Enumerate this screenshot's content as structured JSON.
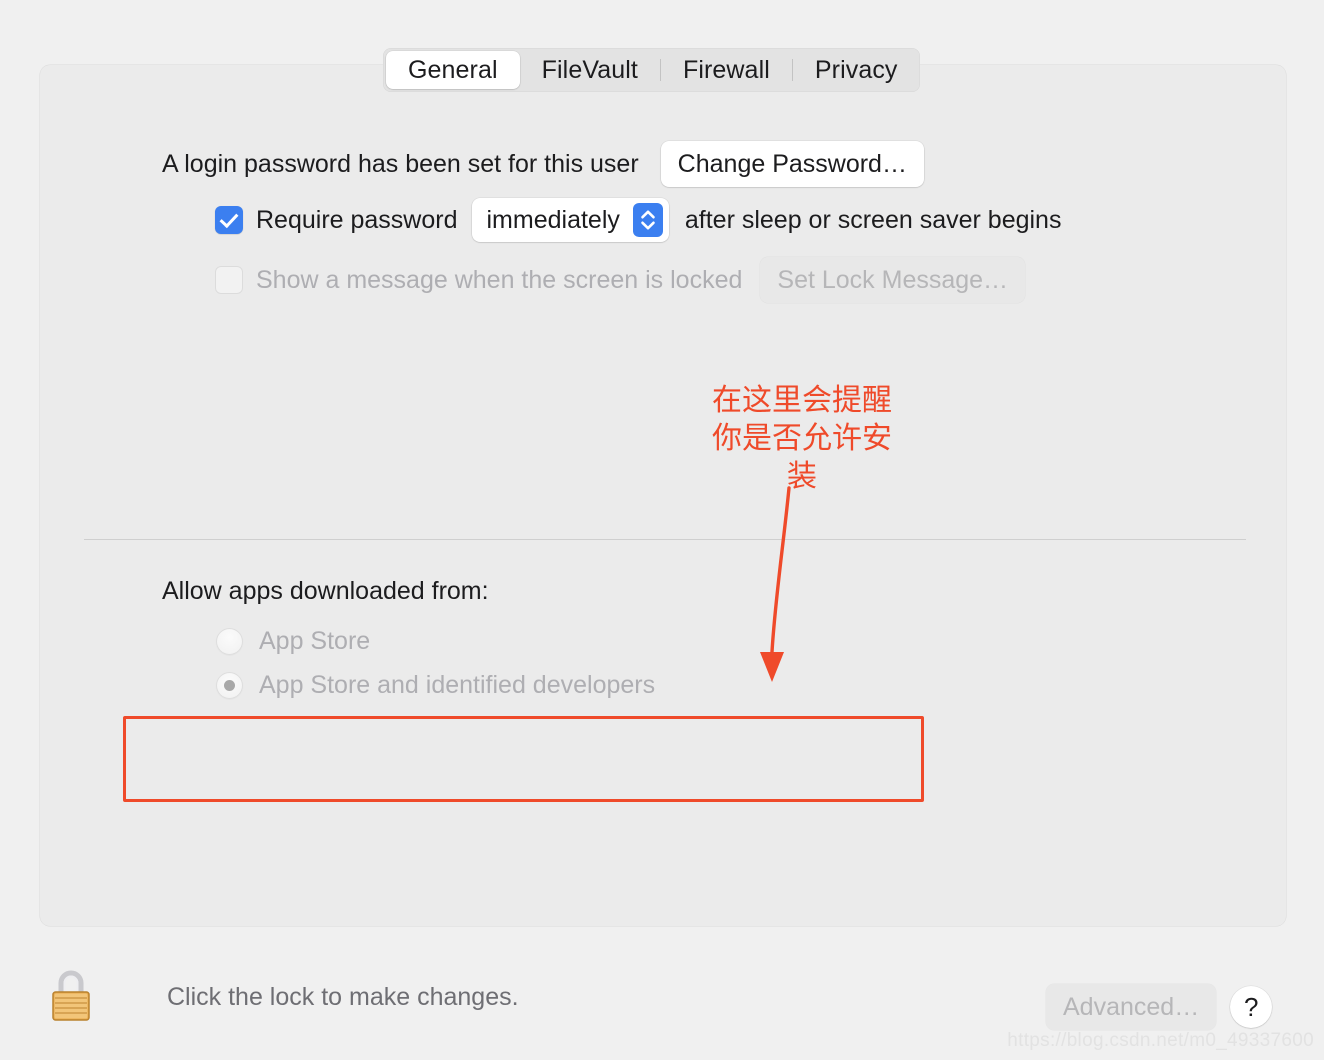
{
  "tabs": [
    {
      "label": "General",
      "active": true
    },
    {
      "label": "FileVault",
      "active": false
    },
    {
      "label": "Firewall",
      "active": false
    },
    {
      "label": "Privacy",
      "active": false
    }
  ],
  "general": {
    "login_password_text": "A login password has been set for this user",
    "change_password_label": "Change Password…",
    "require_password_label": "Require password",
    "require_password_checked": true,
    "require_password_interval": "immediately",
    "require_password_suffix": "after sleep or screen saver begins",
    "show_message_label": "Show a message when the screen is locked",
    "show_message_checked": false,
    "set_lock_message_label": "Set Lock Message…",
    "allow_apps_heading": "Allow apps downloaded from:",
    "allow_apps_options": [
      {
        "label": "App Store",
        "selected": false
      },
      {
        "label": "App Store and identified developers",
        "selected": true
      }
    ]
  },
  "annotation": {
    "text_lines": [
      "在这里会提醒",
      "你是否允许安",
      "装"
    ],
    "color": "#ef4a2a"
  },
  "footer": {
    "lock_text": "Click the lock to make changes.",
    "advanced_label": "Advanced…",
    "help_label": "?"
  },
  "watermark": "https://blog.csdn.net/m0_49337600"
}
